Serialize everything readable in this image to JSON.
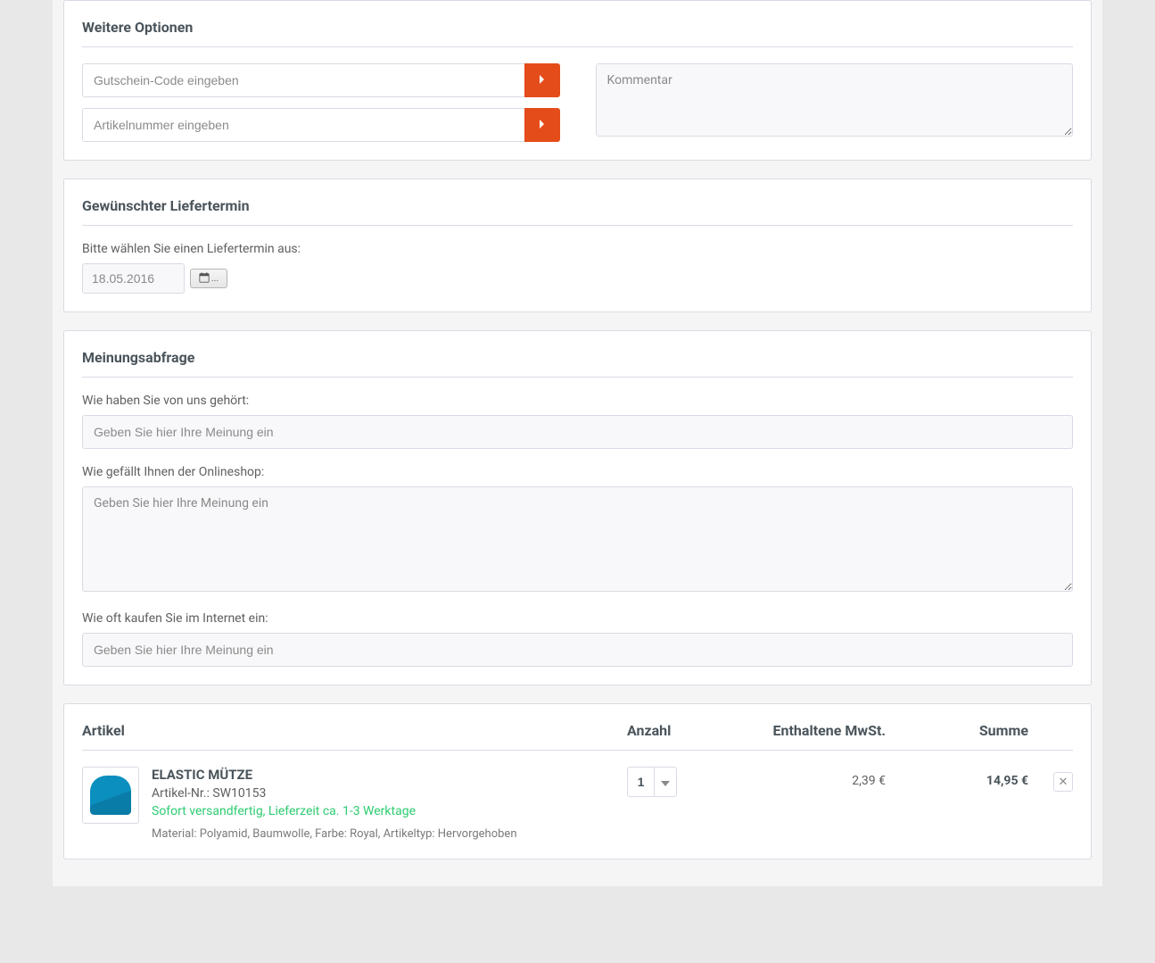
{
  "options": {
    "title": "Weitere Optionen",
    "coupon_placeholder": "Gutschein-Code eingeben",
    "sku_placeholder": "Artikelnummer eingeben",
    "comment_placeholder": "Kommentar"
  },
  "delivery": {
    "title": "Gewünschter Liefertermin",
    "label": "Bitte wählen Sie einen Liefertermin aus:",
    "date_value": "18.05.2016",
    "date_btn_dots": "..."
  },
  "survey": {
    "title": "Meinungsabfrage",
    "q1_label": "Wie haben Sie von uns gehört:",
    "q1_placeholder": "Geben Sie hier Ihre Meinung ein",
    "q2_label": "Wie gefällt Ihnen der Onlineshop:",
    "q2_placeholder": "Geben Sie hier Ihre Meinung ein",
    "q3_label": "Wie oft kaufen Sie im Internet ein:",
    "q3_placeholder": "Geben Sie hier Ihre Meinung ein"
  },
  "cart": {
    "headers": {
      "article": "Artikel",
      "qty": "Anzahl",
      "tax": "Enthaltene MwSt.",
      "sum": "Summe"
    },
    "item": {
      "name": "ELASTIC MÜTZE",
      "sku_prefix": "Artikel-Nr.: ",
      "sku": "SW10153",
      "stock": "Sofort versandfertig, Lieferzeit ca. 1-3 Werktage",
      "meta": "Material: Polyamid, Baumwolle, Farbe: Royal, Artikeltyp: Hervorgehoben",
      "qty": "1",
      "tax": "2,39 €",
      "sum": "14,95 €"
    }
  }
}
